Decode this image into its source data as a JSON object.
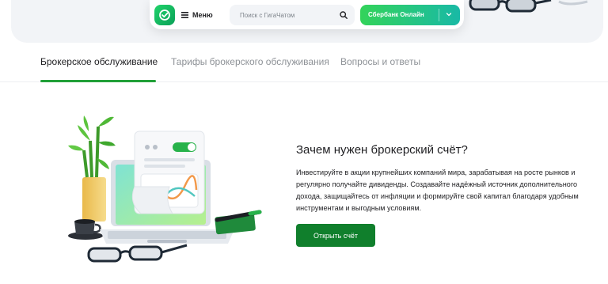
{
  "header": {
    "menu_label": "Меню",
    "search_placeholder": "Поиск с ГигаЧатом",
    "online_button_label": "Сбербанк Онлайн"
  },
  "tabs": [
    {
      "label": "Брокерское обслуживание",
      "active": true
    },
    {
      "label": "Тарифы брокерского обслуживания",
      "active": false
    },
    {
      "label": "Вопросы и ответы",
      "active": false
    }
  ],
  "content": {
    "title": "Зачем нужен брокерский счёт?",
    "description": "Инвестируйте в акции крупнейших компаний мира, зарабатывая на росте рынков и регулярно получайте дивиденды. Создавайте надёжный источник дополнительного дохода, защищайтесь от инфляции и формируйте свой капитал благодаря удобным инструментам и выгодным условиям.",
    "button_label": "Открыть счёт"
  },
  "colors": {
    "accent": "#21a038",
    "primary_button": "#107f2c",
    "hero_background": "#f2f4f7"
  },
  "icons": [
    "sber-logo-icon",
    "menu-icon",
    "search-icon",
    "chevron-down-icon",
    "glasses-icon",
    "bamboo-icon",
    "laptop-icon",
    "coffee-cup-icon",
    "pen-icon",
    "notebook-icon",
    "document-chart-icon"
  ]
}
